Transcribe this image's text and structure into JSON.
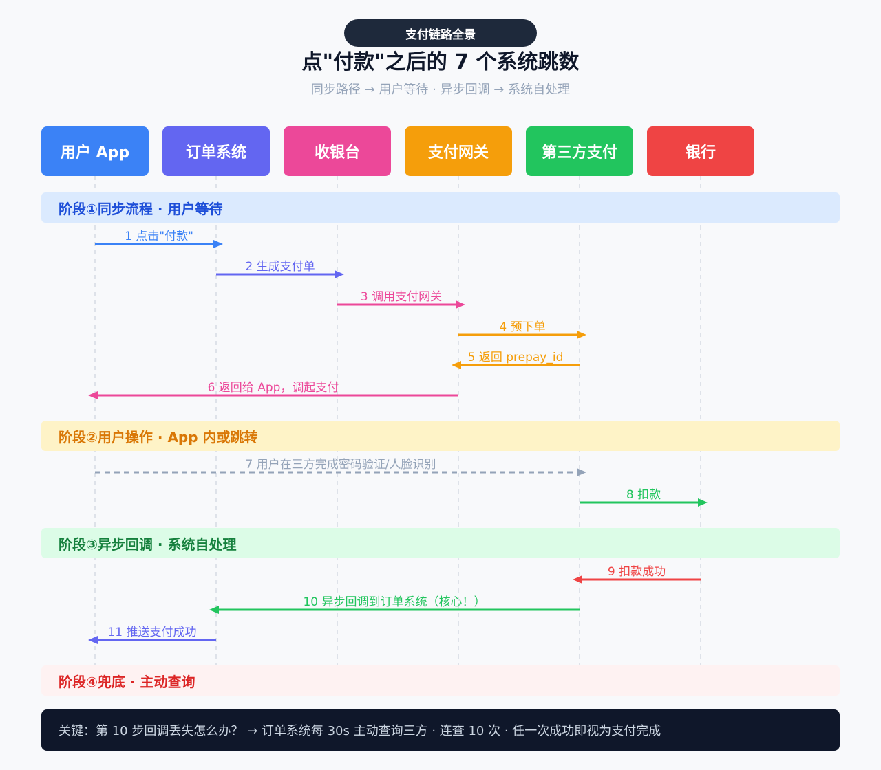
{
  "header": {
    "badge": "支付链路全景",
    "title": "点\"付款\"之后的 7 个系统跳数",
    "subtitle": "同步路径 → 用户等待 · 异步回调 → 系统自处理"
  },
  "actors": [
    {
      "label": "用户 App",
      "color": "#3b82f6"
    },
    {
      "label": "订单系统",
      "color": "#6366f1"
    },
    {
      "label": "收银台",
      "color": "#ec4899"
    },
    {
      "label": "支付网关",
      "color": "#f59e0b"
    },
    {
      "label": "第三方支付",
      "color": "#22c55e"
    },
    {
      "label": "银行",
      "color": "#ef4444"
    }
  ],
  "phases": [
    {
      "label": "阶段①同步流程 · 用户等待"
    },
    {
      "label": "阶段②用户操作 · App 内或跳转"
    },
    {
      "label": "阶段③异步回调 · 系统自处理"
    },
    {
      "label": "阶段④兜底 · 主动查询"
    }
  ],
  "messages": [
    {
      "label": "1 点击\"付款\"",
      "from": 0,
      "to": 1,
      "color": "#3b82f6",
      "dashed": false
    },
    {
      "label": "2 生成支付单",
      "from": 1,
      "to": 2,
      "color": "#6366f1",
      "dashed": false
    },
    {
      "label": "3 调用支付网关",
      "from": 2,
      "to": 3,
      "color": "#ec4899",
      "dashed": false
    },
    {
      "label": "4 预下单",
      "from": 3,
      "to": 4,
      "color": "#f59e0b",
      "dashed": false
    },
    {
      "label": "5 返回 prepay_id",
      "from": 4,
      "to": 3,
      "color": "#f59e0b",
      "dashed": false
    },
    {
      "label": "6 返回给 App，调起支付",
      "from": 3,
      "to": 0,
      "color": "#ec4899",
      "dashed": false
    },
    {
      "label": "7 用户在三方完成密码验证/人脸识别",
      "from": 0,
      "to": 4,
      "color": "#94a3b8",
      "dashed": true
    },
    {
      "label": "8 扣款",
      "from": 4,
      "to": 5,
      "color": "#22c55e",
      "dashed": false
    },
    {
      "label": "9 扣款成功",
      "from": 5,
      "to": 4,
      "color": "#ef4444",
      "dashed": false
    },
    {
      "label": "10 异步回调到订单系统（核心！）",
      "from": 4,
      "to": 1,
      "color": "#22c55e",
      "dashed": false
    },
    {
      "label": "11 推送支付成功",
      "from": 1,
      "to": 0,
      "color": "#6366f1",
      "dashed": false
    }
  ],
  "footer": {
    "text": "关键：第 10 步回调丢失怎么办？ → 订单系统每 30s 主动查询三方 · 连查 10 次 · 任一次成功即视为支付完成"
  }
}
